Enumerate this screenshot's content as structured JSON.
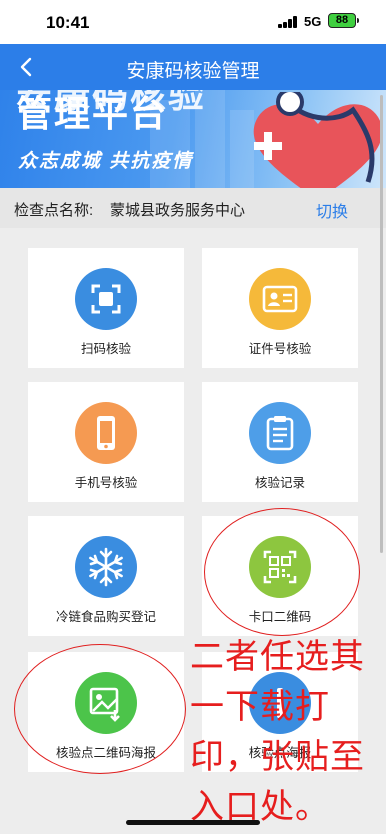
{
  "status_bar": {
    "time": "10:41",
    "network": "5G",
    "battery": "88"
  },
  "navbar": {
    "title": "安康码核验管理",
    "back_icon": "chevron-left-icon"
  },
  "banner": {
    "headline_top": "安康码核验",
    "headline": "管理平台",
    "slogan": "众志成城 共抗疫情"
  },
  "checkpoint": {
    "label": "检查点名称:",
    "name": "蒙城县政务服务中心",
    "switch_label": "切换"
  },
  "grid": [
    {
      "label": "扫码核验",
      "icon": "scan-icon",
      "color": "#3a8de0"
    },
    {
      "label": "证件号核验",
      "icon": "id-card-icon",
      "color": "#f5b93a"
    },
    {
      "label": "手机号核验",
      "icon": "phone-icon",
      "color": "#f59a52"
    },
    {
      "label": "核验记录",
      "icon": "clipboard-icon",
      "color": "#4e9ee8"
    },
    {
      "label": "冷链食品购买登记",
      "icon": "snowflake-icon",
      "color": "#3a8de0"
    },
    {
      "label": "卡口二维码",
      "icon": "qr-code-icon",
      "color": "#8dc63f"
    },
    {
      "label": "核验点二维码海报",
      "icon": "image-download-icon",
      "color": "#4cc44a"
    },
    {
      "label": "核验点海报",
      "icon": "poster-icon",
      "color": "#3a8de0"
    }
  ],
  "annotation": {
    "text": "二者任选其一下载打印，张贴至入口处。",
    "color": "#e61e1e"
  }
}
